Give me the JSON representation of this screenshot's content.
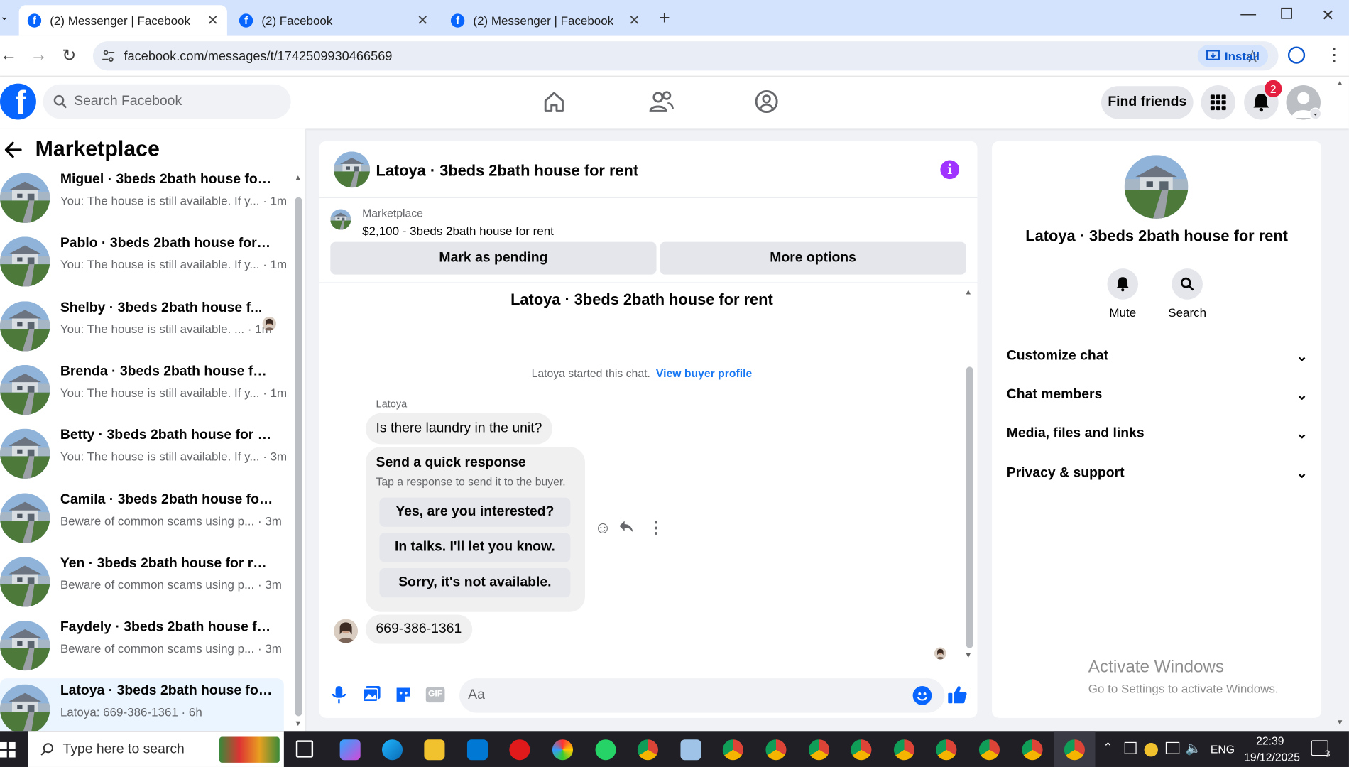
{
  "browser": {
    "tabs": [
      {
        "title": "(2) Messenger | Facebook",
        "active": true
      },
      {
        "title": "(2) Facebook",
        "active": false
      },
      {
        "title": "(2) Messenger | Facebook",
        "active": false
      }
    ],
    "url": "facebook.com/messages/t/1742509930466569",
    "install_label": "Install"
  },
  "fb_header": {
    "search_placeholder": "Search Facebook",
    "find_friends_label": "Find friends",
    "notification_count": "2"
  },
  "sidebar": {
    "title": "Marketplace",
    "conversations": [
      {
        "name": "Miguel · 3beds 2bath house for ...",
        "preview": "You: The house is still available. If y...",
        "time": "1m",
        "selected": false
      },
      {
        "name": "Pablo · 3beds 2bath house for re...",
        "preview": "You: The house is still available. If y...",
        "time": "1m",
        "selected": false
      },
      {
        "name": "Shelby · 3beds 2bath house f...",
        "preview": "You: The house is still available. ...",
        "time": "1m",
        "selected": false
      },
      {
        "name": "Brenda · 3beds 2bath house for ...",
        "preview": "You: The house is still available. If y...",
        "time": "1m",
        "selected": false
      },
      {
        "name": "Betty · 3beds 2bath house for rent",
        "preview": "You: The house is still available. If y...",
        "time": "3m",
        "selected": false
      },
      {
        "name": "Camila · 3beds 2bath house for r...",
        "preview": "Beware of common scams using p...",
        "time": "3m",
        "selected": false
      },
      {
        "name": "Yen · 3beds 2bath house for rent",
        "preview": "Beware of common scams using p...",
        "time": "3m",
        "selected": false
      },
      {
        "name": "Faydely · 3beds 2bath house for ...",
        "preview": "Beware of common scams using p...",
        "time": "3m",
        "selected": false
      },
      {
        "name": "Latoya · 3beds 2bath house for r...",
        "preview": "Latoya: 669-386-1361",
        "time": "6h",
        "selected": true
      }
    ]
  },
  "chat": {
    "title": "Latoya · 3beds 2bath house for rent",
    "listing": {
      "source": "Marketplace",
      "summary": "$2,100 - 3beds 2bath house for rent",
      "mark_pending_label": "Mark as pending",
      "more_options_label": "More options"
    },
    "thread_title": "Latoya · 3beds 2bath house for rent",
    "started_text": "Latoya started this chat.",
    "view_profile_link": "View buyer profile",
    "sender_name": "Latoya",
    "messages": [
      {
        "from": "Latoya",
        "text": "Is there laundry in the unit?"
      },
      {
        "from": "Latoya",
        "text": "669-386-1361"
      }
    ],
    "quick_response": {
      "title": "Send a quick response",
      "subtitle": "Tap a response to send it to the buyer.",
      "options": [
        "Yes, are you interested?",
        "In talks. I'll let you know.",
        "Sorry, it's not available."
      ]
    },
    "input_placeholder": "Aa"
  },
  "info_panel": {
    "name": "Latoya · 3beds 2bath house for rent",
    "actions": [
      {
        "label": "Mute",
        "icon": "bell-icon"
      },
      {
        "label": "Search",
        "icon": "search-icon"
      }
    ],
    "sections": [
      "Customize chat",
      "Chat members",
      "Media, files and links",
      "Privacy & support"
    ]
  },
  "watermark": {
    "title": "Activate Windows",
    "subtitle": "Go to Settings to activate Windows."
  },
  "taskbar": {
    "search_placeholder": "Type here to search",
    "language": "ENG",
    "time": "22:39",
    "date": "19/12/2025",
    "notification_count": "3"
  },
  "colors": {
    "facebook_blue": "#0866FF",
    "link_blue": "#1877F2",
    "selected_bg": "#EBF5FF",
    "info_purple": "#A033FF",
    "badge_red": "#E41E3F"
  }
}
